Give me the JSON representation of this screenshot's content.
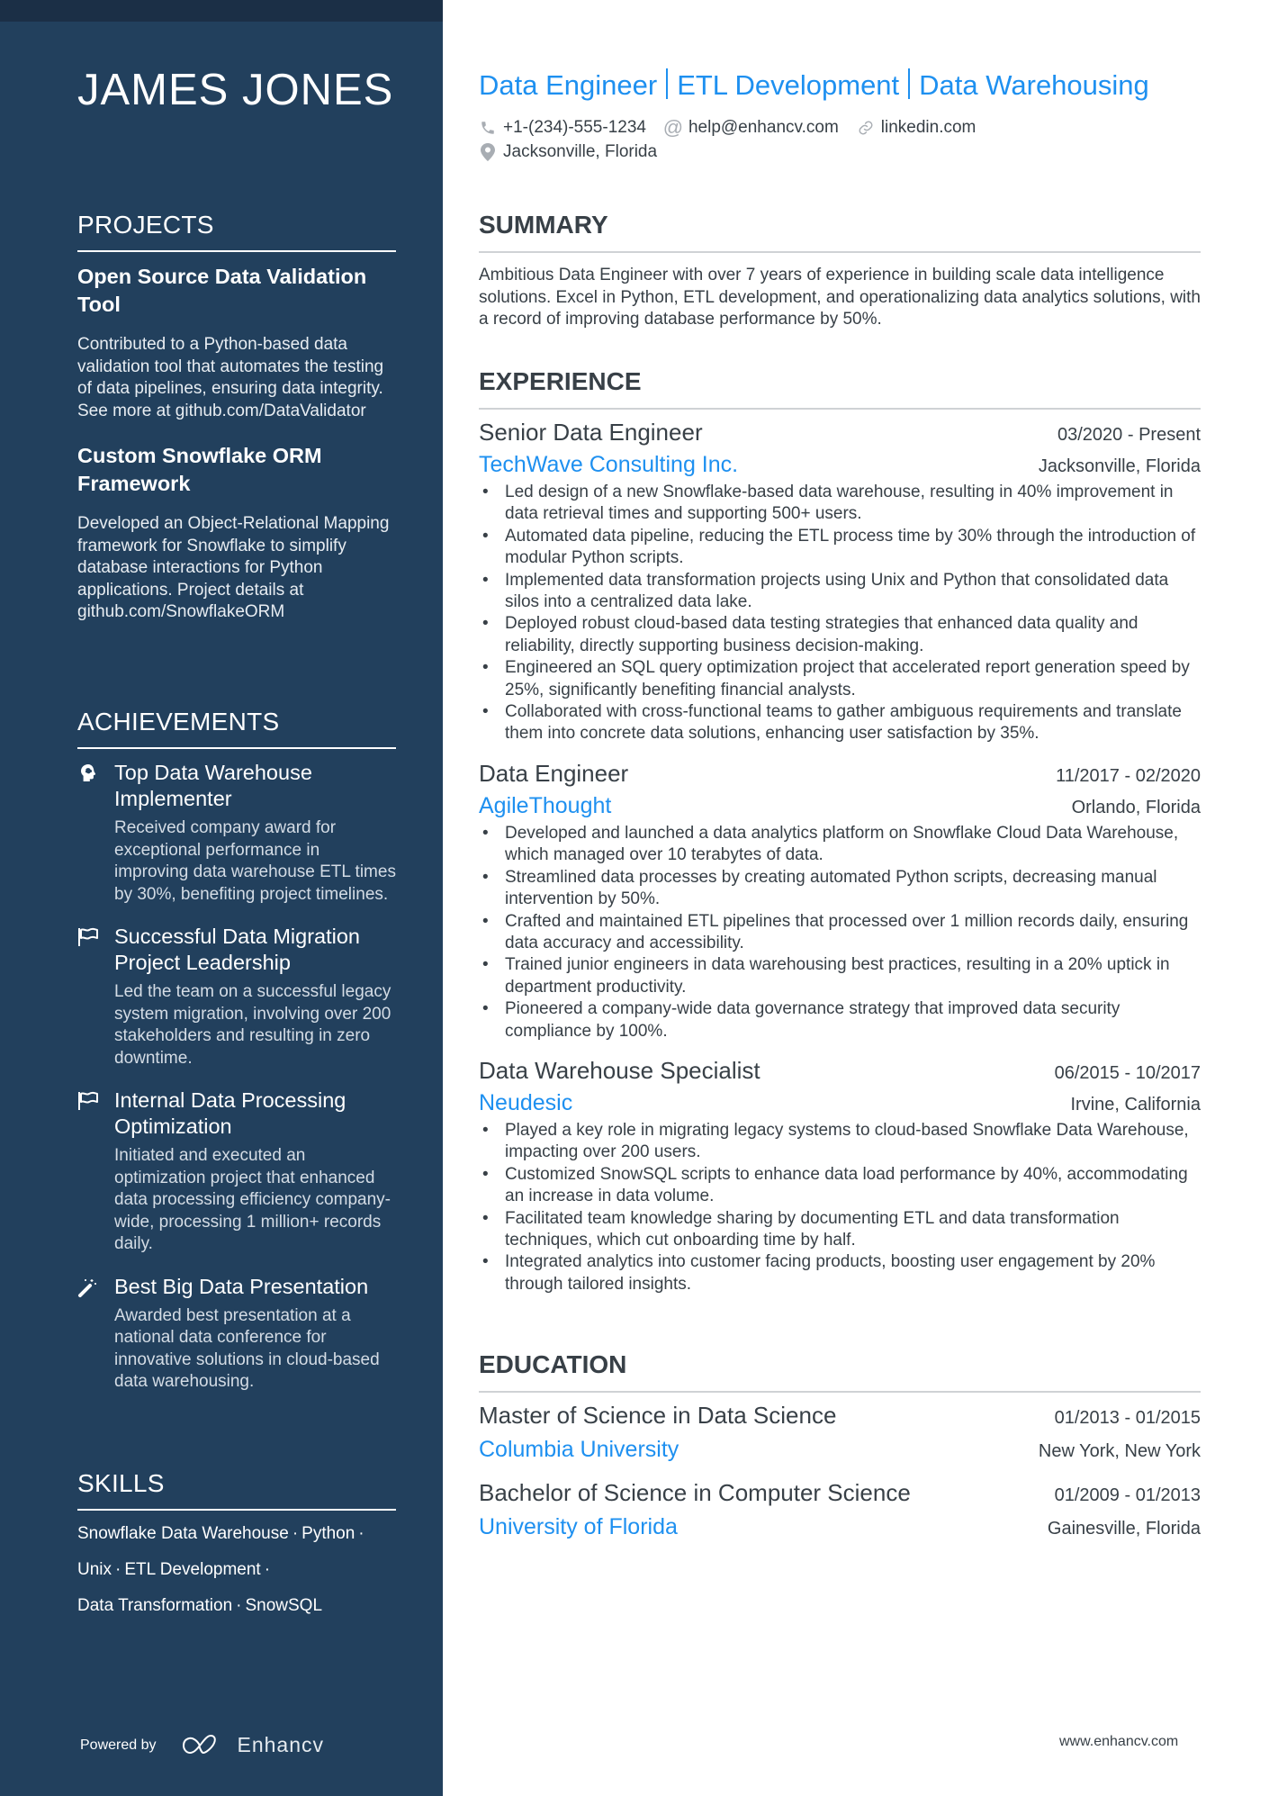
{
  "sidebar": {
    "name": "JAMES JONES",
    "projects": {
      "heading": "PROJECTS",
      "items": [
        {
          "title": "Open Source Data Validation Tool",
          "description": "Contributed to a Python-based data validation tool that automates the testing of data pipelines, ensuring data integrity. See more at github.com/DataValidator"
        },
        {
          "title": "Custom Snowflake ORM Framework",
          "description": "Developed an Object-Relational Mapping framework for Snowflake to simplify database interactions for Python applications. Project details at github.com/SnowflakeORM"
        }
      ]
    },
    "achievements": {
      "heading": "ACHIEVEMENTS",
      "items": [
        {
          "icon": "brain-head-icon",
          "title": "Top Data Warehouse Implementer",
          "description": "Received company award for exceptional performance in improving data warehouse ETL times by 30%, benefiting project timelines."
        },
        {
          "icon": "flag-icon",
          "title": "Successful Data Migration Project Leadership",
          "description": "Led the team on a successful legacy system migration, involving over 200 stakeholders and resulting in zero downtime."
        },
        {
          "icon": "flag-icon",
          "title": "Internal Data Processing Optimization",
          "description": "Initiated and executed an optimization project that enhanced data processing efficiency company-wide, processing 1 million+ records daily."
        },
        {
          "icon": "magic-wand-icon",
          "title": "Best Big Data Presentation",
          "description": "Awarded best presentation at a national data conference for innovative solutions in cloud-based data warehousing."
        }
      ]
    },
    "skills": {
      "heading": "SKILLS",
      "lines": [
        [
          "Snowflake Data Warehouse",
          "Python",
          ""
        ],
        [
          "Unix",
          "ETL Development",
          ""
        ],
        [
          "Data Transformation",
          "SnowSQL"
        ]
      ],
      "separator": "·"
    },
    "footer": {
      "powered_by": "Powered by",
      "brand": "Enhancv"
    }
  },
  "header": {
    "titles": [
      "Data Engineer",
      "ETL Development",
      "Data Warehousing"
    ],
    "phone": "+1-(234)-555-1234",
    "email": "help@enhancv.com",
    "link": "linkedin.com",
    "location": "Jacksonville, Florida"
  },
  "summary": {
    "heading": "SUMMARY",
    "text": "Ambitious Data Engineer with over 7 years of experience in building scale data intelligence solutions. Excel in Python, ETL development, and operationalizing data analytics solutions, with a record of improving database performance by 50%."
  },
  "experience": {
    "heading": "EXPERIENCE",
    "jobs": [
      {
        "title": "Senior Data Engineer",
        "dates": "03/2020 - Present",
        "company": "TechWave Consulting Inc.",
        "location": "Jacksonville, Florida",
        "bullets": [
          "Led design of a new Snowflake-based data warehouse, resulting in 40% improvement in data retrieval times and supporting 500+ users.",
          "Automated data pipeline, reducing the ETL process time by 30% through the introduction of modular Python scripts.",
          "Implemented data transformation projects using Unix and Python that consolidated data silos into a centralized data lake.",
          "Deployed robust cloud-based data testing strategies that enhanced data quality and reliability, directly supporting business decision-making.",
          "Engineered an SQL query optimization project that accelerated report generation speed by 25%, significantly benefiting financial analysts.",
          "Collaborated with cross-functional teams to gather ambiguous requirements and translate them into concrete data solutions, enhancing user satisfaction by 35%."
        ]
      },
      {
        "title": "Data Engineer",
        "dates": "11/2017 - 02/2020",
        "company": "AgileThought",
        "location": "Orlando, Florida",
        "bullets": [
          "Developed and launched a data analytics platform on Snowflake Cloud Data Warehouse, which managed over 10 terabytes of data.",
          "Streamlined data processes by creating automated Python scripts, decreasing manual intervention by 50%.",
          "Crafted and maintained ETL pipelines that processed over 1 million records daily, ensuring data accuracy and accessibility.",
          "Trained junior engineers in data warehousing best practices, resulting in a 20% uptick in department productivity.",
          "Pioneered a company-wide data governance strategy that improved data security compliance by 100%."
        ]
      },
      {
        "title": "Data Warehouse Specialist",
        "dates": "06/2015 - 10/2017",
        "company": "Neudesic",
        "location": "Irvine, California",
        "bullets": [
          "Played a key role in migrating legacy systems to cloud-based Snowflake Data Warehouse, impacting over 200 users.",
          "Customized SnowSQL scripts to enhance data load performance by 40%, accommodating an increase in data volume.",
          "Facilitated team knowledge sharing by documenting ETL and data transformation techniques, which cut onboarding time by half.",
          "Integrated analytics into customer facing products, boosting user engagement by 20% through tailored insights."
        ]
      }
    ]
  },
  "education": {
    "heading": "EDUCATION",
    "items": [
      {
        "degree": "Master of Science in Data Science",
        "dates": "01/2013 - 01/2015",
        "school": "Columbia University",
        "location": "New York, New York"
      },
      {
        "degree": "Bachelor of Science in Computer Science",
        "dates": "01/2009 - 01/2013",
        "school": "University of Florida",
        "location": "Gainesville, Florida"
      }
    ]
  },
  "footer": {
    "url": "www.enhancv.com"
  },
  "colors": {
    "sidebar_bg": "#22405d",
    "sidebar_band": "#1b2f46",
    "accent": "#1e90f0",
    "text": "#384047",
    "icon_gray": "#a8adb3"
  }
}
